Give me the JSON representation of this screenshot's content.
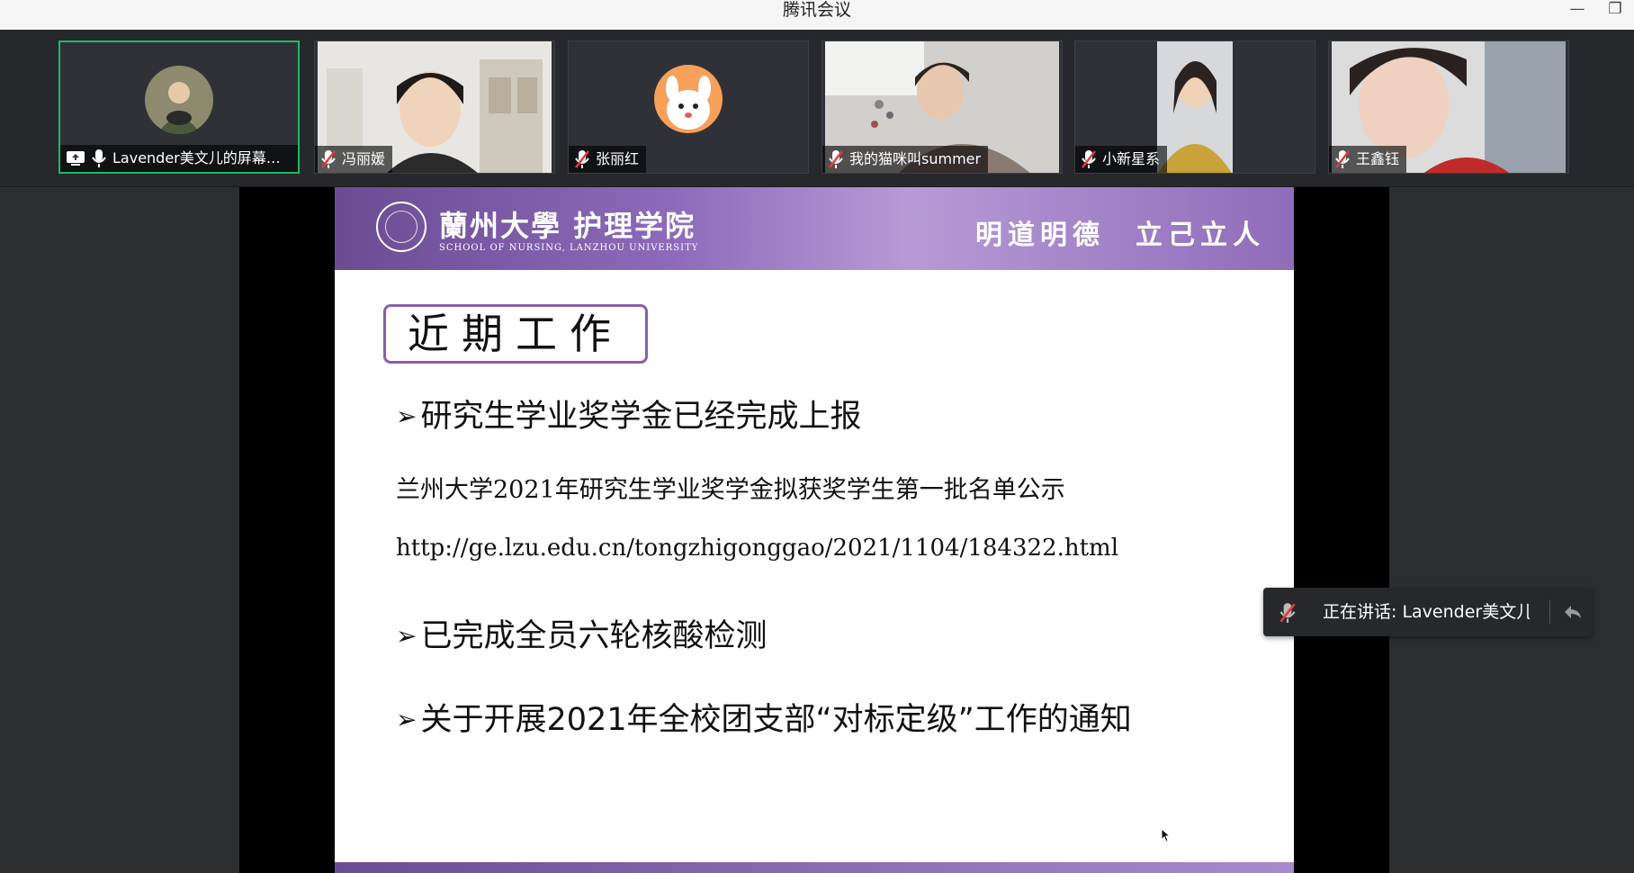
{
  "window": {
    "title": "腾讯会议",
    "minimize": "—",
    "restore": "❐"
  },
  "participants": [
    {
      "name": "Lavender美文儿的屏幕共...",
      "sharing": true,
      "muted": false
    },
    {
      "name": "冯丽媛",
      "muted": true
    },
    {
      "name": "张丽红",
      "muted": true
    },
    {
      "name": "我的猫咪叫summer",
      "muted": true
    },
    {
      "name": "小新星系",
      "muted": true
    },
    {
      "name": "王鑫钰",
      "muted": true
    }
  ],
  "slide": {
    "school_cn": "蘭州大學 护理学院",
    "school_en": "SCHOOL OF NURSING, LANZHOU UNIVERSITY",
    "motto_1": "明道明德",
    "motto_2": "立己立人",
    "title": "近期工作",
    "arrow": "➢",
    "items": [
      "研究生学业奖学金已经完成上报",
      "已完成全员六轮核酸检测",
      "关于开展2021年全校团支部“对标定级”工作的通知"
    ],
    "notice": "兰州大学2021年研究生学业奖学金拟获奖学生第一批名单公示",
    "url": "http://ge.lzu.edu.cn/tongzhigonggao/2021/1104/184322.html"
  },
  "speaking": {
    "text": "正在讲话: Lavender美文儿;"
  },
  "colors": {
    "accent_green": "#1fb86a",
    "slide_purple": "#8a5fa8",
    "mute_red": "#e23c3c"
  }
}
